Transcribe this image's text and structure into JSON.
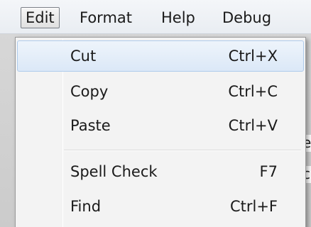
{
  "menubar": {
    "items": [
      {
        "label": "Edit",
        "active": true
      },
      {
        "label": "Format"
      },
      {
        "label": "Help"
      },
      {
        "label": "Debug"
      }
    ]
  },
  "edit_menu": {
    "items": [
      {
        "label": "Cut",
        "shortcut": "Ctrl+X",
        "highlighted": true
      },
      {
        "label": "Copy",
        "shortcut": "Ctrl+C"
      },
      {
        "label": "Paste",
        "shortcut": "Ctrl+V"
      },
      {
        "separator": true
      },
      {
        "label": "Spell Check",
        "shortcut": "F7"
      },
      {
        "label": "Find",
        "shortcut": "Ctrl+F"
      }
    ]
  },
  "background_fragments": [
    "e",
    "c"
  ],
  "colors": {
    "menubar_bg": "#eef1f5",
    "menu_bg": "#f3f3f3",
    "highlight_bg": "#dbe8f7",
    "highlight_border": "#aecbeb"
  }
}
